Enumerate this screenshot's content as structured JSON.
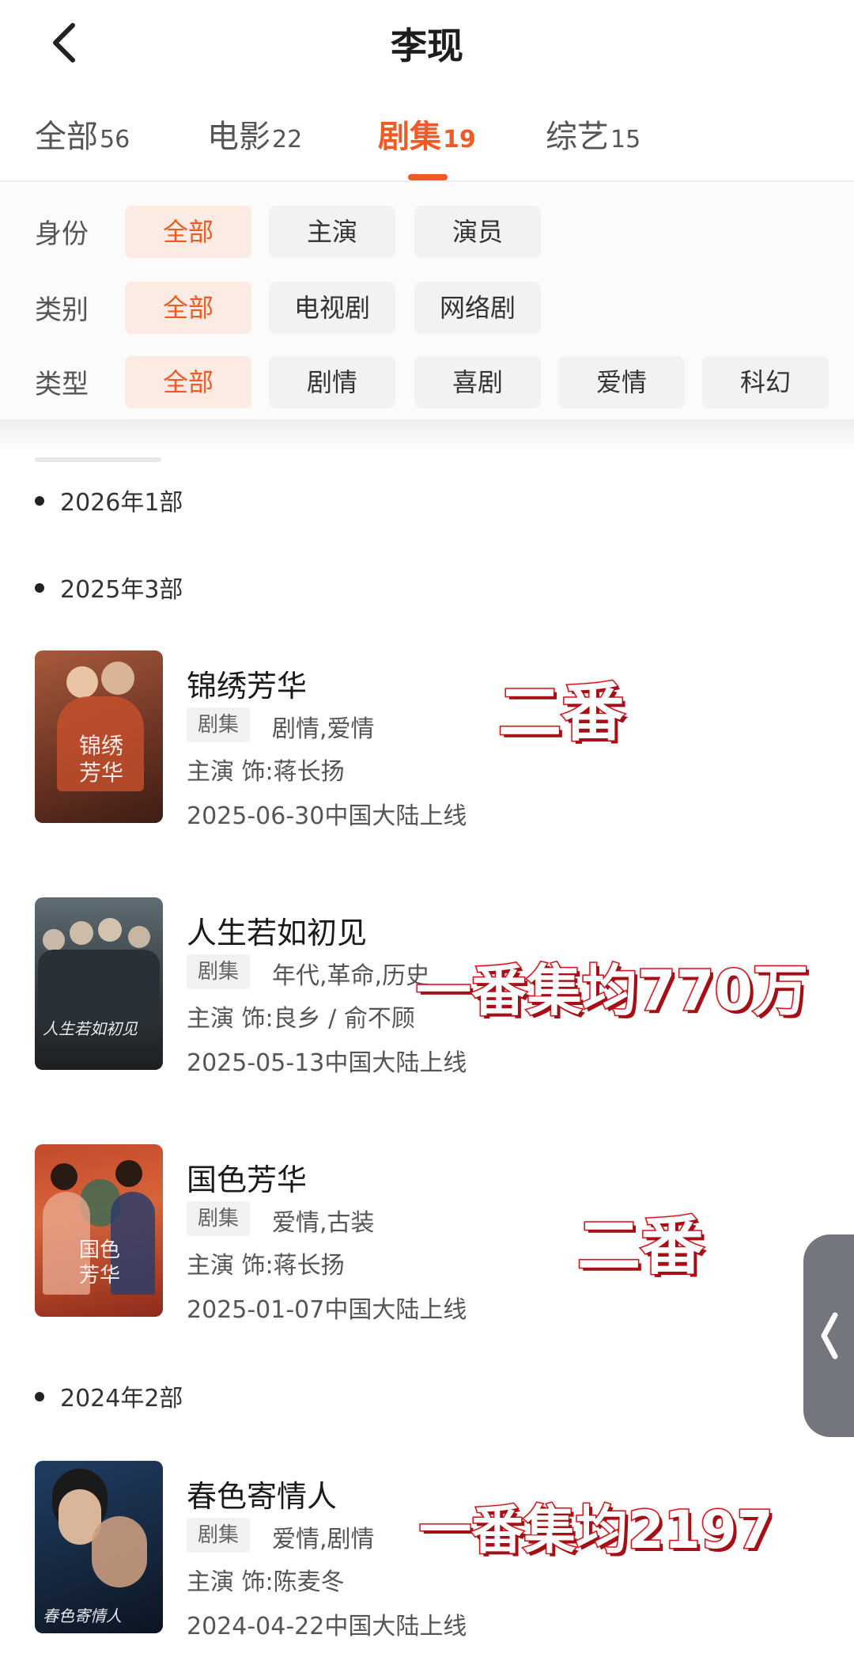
{
  "header": {
    "title": "李现"
  },
  "tabs": [
    {
      "label": "全部",
      "count": "56"
    },
    {
      "label": "电影",
      "count": "22"
    },
    {
      "label": "剧集",
      "count": "19"
    },
    {
      "label": "综艺",
      "count": "15"
    }
  ],
  "active_tab": "剧集",
  "filters": {
    "identity": {
      "label": "身份",
      "options": [
        "全部",
        "主演",
        "演员"
      ],
      "selected": "全部"
    },
    "category": {
      "label": "类别",
      "options": [
        "全部",
        "电视剧",
        "网络剧"
      ],
      "selected": "全部"
    },
    "genre": {
      "label": "类型",
      "options": [
        "全部",
        "剧情",
        "喜剧",
        "爱情",
        "科幻"
      ],
      "selected": "全部"
    }
  },
  "years": [
    {
      "label": "2026年1部"
    },
    {
      "label": "2025年3部"
    },
    {
      "label": "2024年2部"
    }
  ],
  "items": [
    {
      "title": "锦绣芳华",
      "tag": "剧集",
      "genres": "剧情,爱情",
      "role": "主演 饰:蒋长扬",
      "release": "2025-06-30中国大陆上线",
      "poster_text": "锦绣芳华",
      "annotation": "二番"
    },
    {
      "title": "人生若如初见",
      "tag": "剧集",
      "genres": "年代,革命,历史",
      "role": "主演 饰:良乡 / 俞不顾",
      "release": "2025-05-13中国大陆上线",
      "poster_text": "人生若如初见",
      "annotation": "一番集均770万"
    },
    {
      "title": "国色芳华",
      "tag": "剧集",
      "genres": "爱情,古装",
      "role": "主演 饰:蒋长扬",
      "release": "2025-01-07中国大陆上线",
      "poster_text": "国色芳华",
      "annotation": "二番"
    },
    {
      "title": "春色寄情人",
      "tag": "剧集",
      "genres": "爱情,剧情",
      "role": "主演 饰:陈麦冬",
      "release": "2024-04-22中国大陆上线",
      "poster_text": "春色寄情人",
      "annotation": "一番集均2197"
    }
  ],
  "colors": {
    "accent": "#f05a24",
    "annotation": "#d4141c",
    "chip_bg": "#f1f2f4",
    "chip_active_bg": "#fcebe3"
  },
  "icons": {
    "back": "chevron-left-icon",
    "side_handle": "chevron-left-icon"
  }
}
